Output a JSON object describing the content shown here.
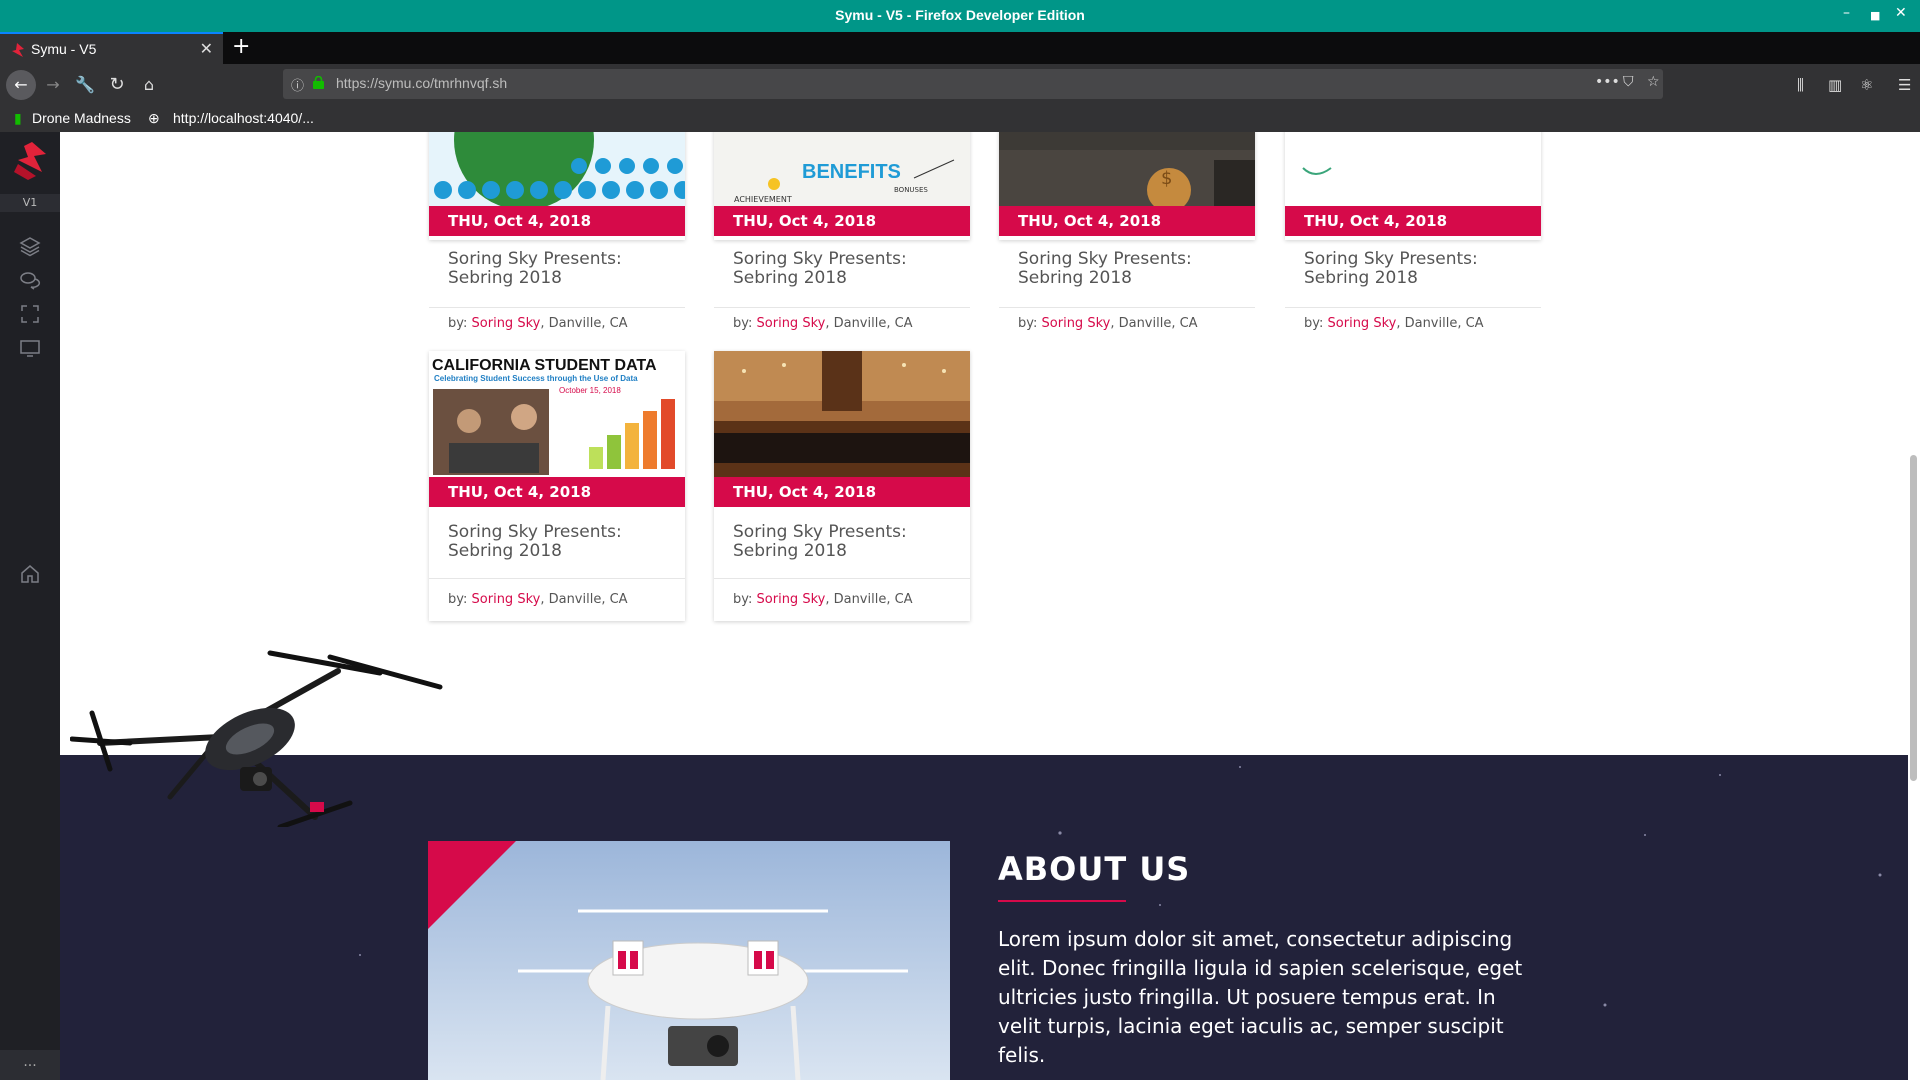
{
  "window": {
    "title": "Symu - V5 - Firefox Developer Edition"
  },
  "tab": {
    "label": "Symu - V5",
    "close": "✕",
    "new_tab": "+"
  },
  "address": {
    "url_host": "https://symu.co",
    "url_path": "/tmrhnvqf.sh"
  },
  "bookmarks": [
    {
      "label": "Drone Madness"
    },
    {
      "label": "http://localhost:4040/..."
    }
  ],
  "sidebar": {
    "version": "V1",
    "more": "..."
  },
  "events": [
    {
      "date": "THU, Oct 4, 2018",
      "title": "Soring Sky Presents: Sebring 2018",
      "by_prefix": "by:",
      "author": "Soring Sky",
      "location": ", Danville, CA",
      "image": "pet-icons-banner"
    },
    {
      "date": "THU, Oct 4, 2018",
      "title": "Soring Sky Presents: Sebring 2018",
      "by_prefix": "by:",
      "author": "Soring Sky",
      "location": ", Danville, CA",
      "image": "benefits-banner"
    },
    {
      "date": "THU, Oct 4, 2018",
      "title": "Soring Sky Presents: Sebring 2018",
      "by_prefix": "by:",
      "author": "Soring Sky",
      "location": ", Danville, CA",
      "image": "money-hand-banner"
    },
    {
      "date": "THU, Oct 4, 2018",
      "title": "Soring Sky Presents: Sebring 2018",
      "by_prefix": "by:",
      "author": "Soring Sky",
      "location": ", Danville, CA",
      "image": "globe-banner"
    },
    {
      "date": "THU, Oct 4, 2018",
      "title": "Soring Sky Presents: Sebring 2018",
      "by_prefix": "by:",
      "author": "Soring Sky",
      "location": ", Danville, CA",
      "image": "california-student-data",
      "img_heading": "CALIFORNIA STUDENT DATA",
      "img_sub": "Celebrating Student Success through the Use of Data",
      "img_date": "October 15, 2018"
    },
    {
      "date": "THU, Oct 4, 2018",
      "title": "Soring Sky Presents: Sebring 2018",
      "by_prefix": "by:",
      "author": "Soring Sky",
      "location": ", Danville, CA",
      "image": "orchestra-hall"
    }
  ],
  "about": {
    "title": "ABOUT US",
    "text": "Lorem ipsum dolor sit amet, consectetur adipiscing elit. Donec fringilla ligula id sapien scelerisque, eget ultricies justo fringilla. Ut posuere tempus erat. In velit turpis, lacinia eget iaculis ac, semper suscipit felis."
  },
  "colors": {
    "accent": "#d60a4a",
    "titlebar": "#009688",
    "dark_section": "#22223a"
  }
}
